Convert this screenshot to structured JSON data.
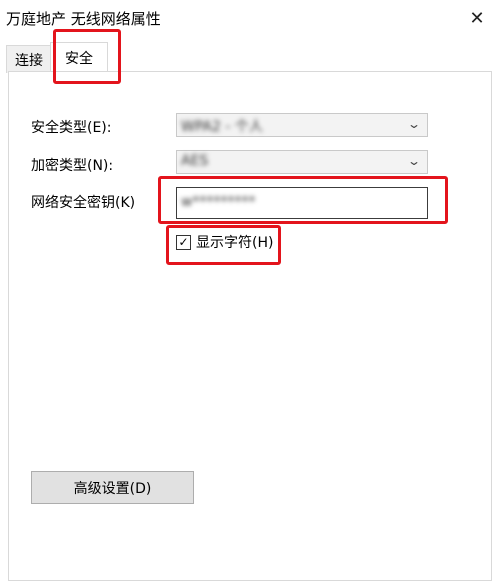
{
  "window": {
    "title": "万庭地产 无线网络属性",
    "close_glyph": "✕"
  },
  "tabs": [
    {
      "label": "连接",
      "selected": false
    },
    {
      "label": "安全",
      "selected": true
    }
  ],
  "form": {
    "security_type": {
      "label": "安全类型(E):",
      "value": "WPA2 - 个人"
    },
    "encryption_type": {
      "label": "加密类型(N):",
      "value": "AES"
    },
    "network_key": {
      "label": "网络安全密钥(K)",
      "value": "w*********"
    },
    "show_chars": {
      "label": "显示字符(H)",
      "checked": true
    }
  },
  "advanced_button": {
    "label": "高级设置(D)"
  },
  "colors": {
    "highlight": "#e3141c",
    "button_bg": "#e1e1e1"
  },
  "icons": {
    "dropdown": "chevron-down-icon",
    "check": "checkmark-icon",
    "close": "close-icon"
  }
}
